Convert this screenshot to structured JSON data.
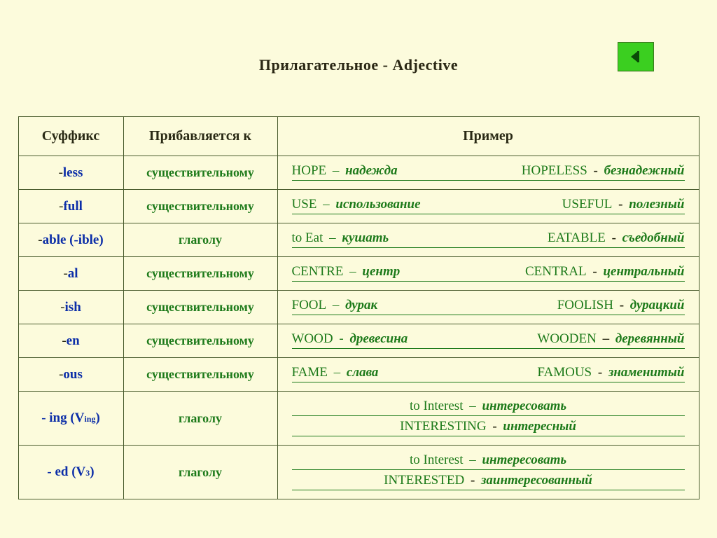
{
  "title": "Прилагательное - Adjective",
  "nav_icon": "back-arrow",
  "headers": {
    "suffix": "Суффикс",
    "add_to": "Прибавляется к",
    "example": "Пример"
  },
  "rows": [
    {
      "suffix_dash": "-",
      "suffix": "less",
      "add_to": "существительному",
      "ex": [
        {
          "src_upper": true,
          "src": "Hope",
          "sep1": " – ",
          "src_trans": "надежда",
          "res_upper": true,
          "result": "Hopeless",
          "sep2": " - ",
          "res_trans": "безнадежный"
        }
      ]
    },
    {
      "suffix_dash": "-",
      "suffix": "full",
      "add_to": "существительному",
      "ex": [
        {
          "src_upper": true,
          "src": "Use",
          "sep1": " – ",
          "src_trans": "использование",
          "res_upper": true,
          "result": "Useful",
          "sep2": " - ",
          "res_trans": "полезный"
        }
      ]
    },
    {
      "suffix_dash": "-",
      "suffix": "able (-ible)",
      "add_to": "глаголу",
      "ex": [
        {
          "src_upper": false,
          "src": "to Eat",
          "sep1": " – ",
          "src_trans": "кушать",
          "res_upper": true,
          "result": "Eatable",
          "sep2": " - ",
          "res_trans": "съедобный"
        }
      ]
    },
    {
      "suffix_dash": "-",
      "suffix": "al",
      "add_to": "существительному",
      "ex": [
        {
          "src_upper": true,
          "src": "Centre",
          "sep1": " – ",
          "src_trans": "центр",
          "res_upper": true,
          "result": "Central",
          "sep2": " - ",
          "res_trans": "центральный"
        }
      ]
    },
    {
      "suffix_dash": "-",
      "suffix": "ish",
      "add_to": "существительному",
      "ex": [
        {
          "src_upper": true,
          "src": "Fool",
          "sep1": " – ",
          "src_trans": "дурак",
          "res_upper": true,
          "result": "Foolish",
          "sep2": " - ",
          "res_trans": "дурацкий"
        }
      ]
    },
    {
      "suffix_dash": "-",
      "suffix": "en",
      "add_to": "существительному",
      "ex": [
        {
          "src_upper": true,
          "src": "Wood",
          "sep1": " - ",
          "src_trans": "древесина",
          "res_upper": true,
          "result": "Wooden",
          "sep2": " – ",
          "res_trans": "деревянный"
        }
      ]
    },
    {
      "suffix_dash": "-",
      "suffix": "ous",
      "add_to": "существительному",
      "ex": [
        {
          "src_upper": true,
          "src": "Fame",
          "sep1": " – ",
          "src_trans": "слава",
          "res_upper": true,
          "result": "Famous",
          "sep2": " - ",
          "res_trans": "знаменитый"
        }
      ]
    },
    {
      "suffix_full": "- ing (V",
      "suffix_sub": "ing",
      "suffix_tail": ")",
      "add_to": "глаголу",
      "ex": [
        {
          "center": true,
          "src_upper": false,
          "src": "to Interest",
          "sep1": " – ",
          "src_trans": "интересовать"
        },
        {
          "center": true,
          "res_upper": true,
          "result": "Interesting",
          "sep2": " - ",
          "res_trans": "интересный"
        }
      ]
    },
    {
      "suffix_full": "- ed (V",
      "suffix_sub": "3",
      "suffix_tail": ")",
      "add_to": "глаголу",
      "ex": [
        {
          "center": true,
          "src_upper": false,
          "src": "to Interest",
          "sep1": " – ",
          "src_trans": "интересовать"
        },
        {
          "center": true,
          "res_upper": true,
          "result": "Interested",
          "sep2": " - ",
          "res_trans": "заинтересованный"
        }
      ]
    }
  ]
}
